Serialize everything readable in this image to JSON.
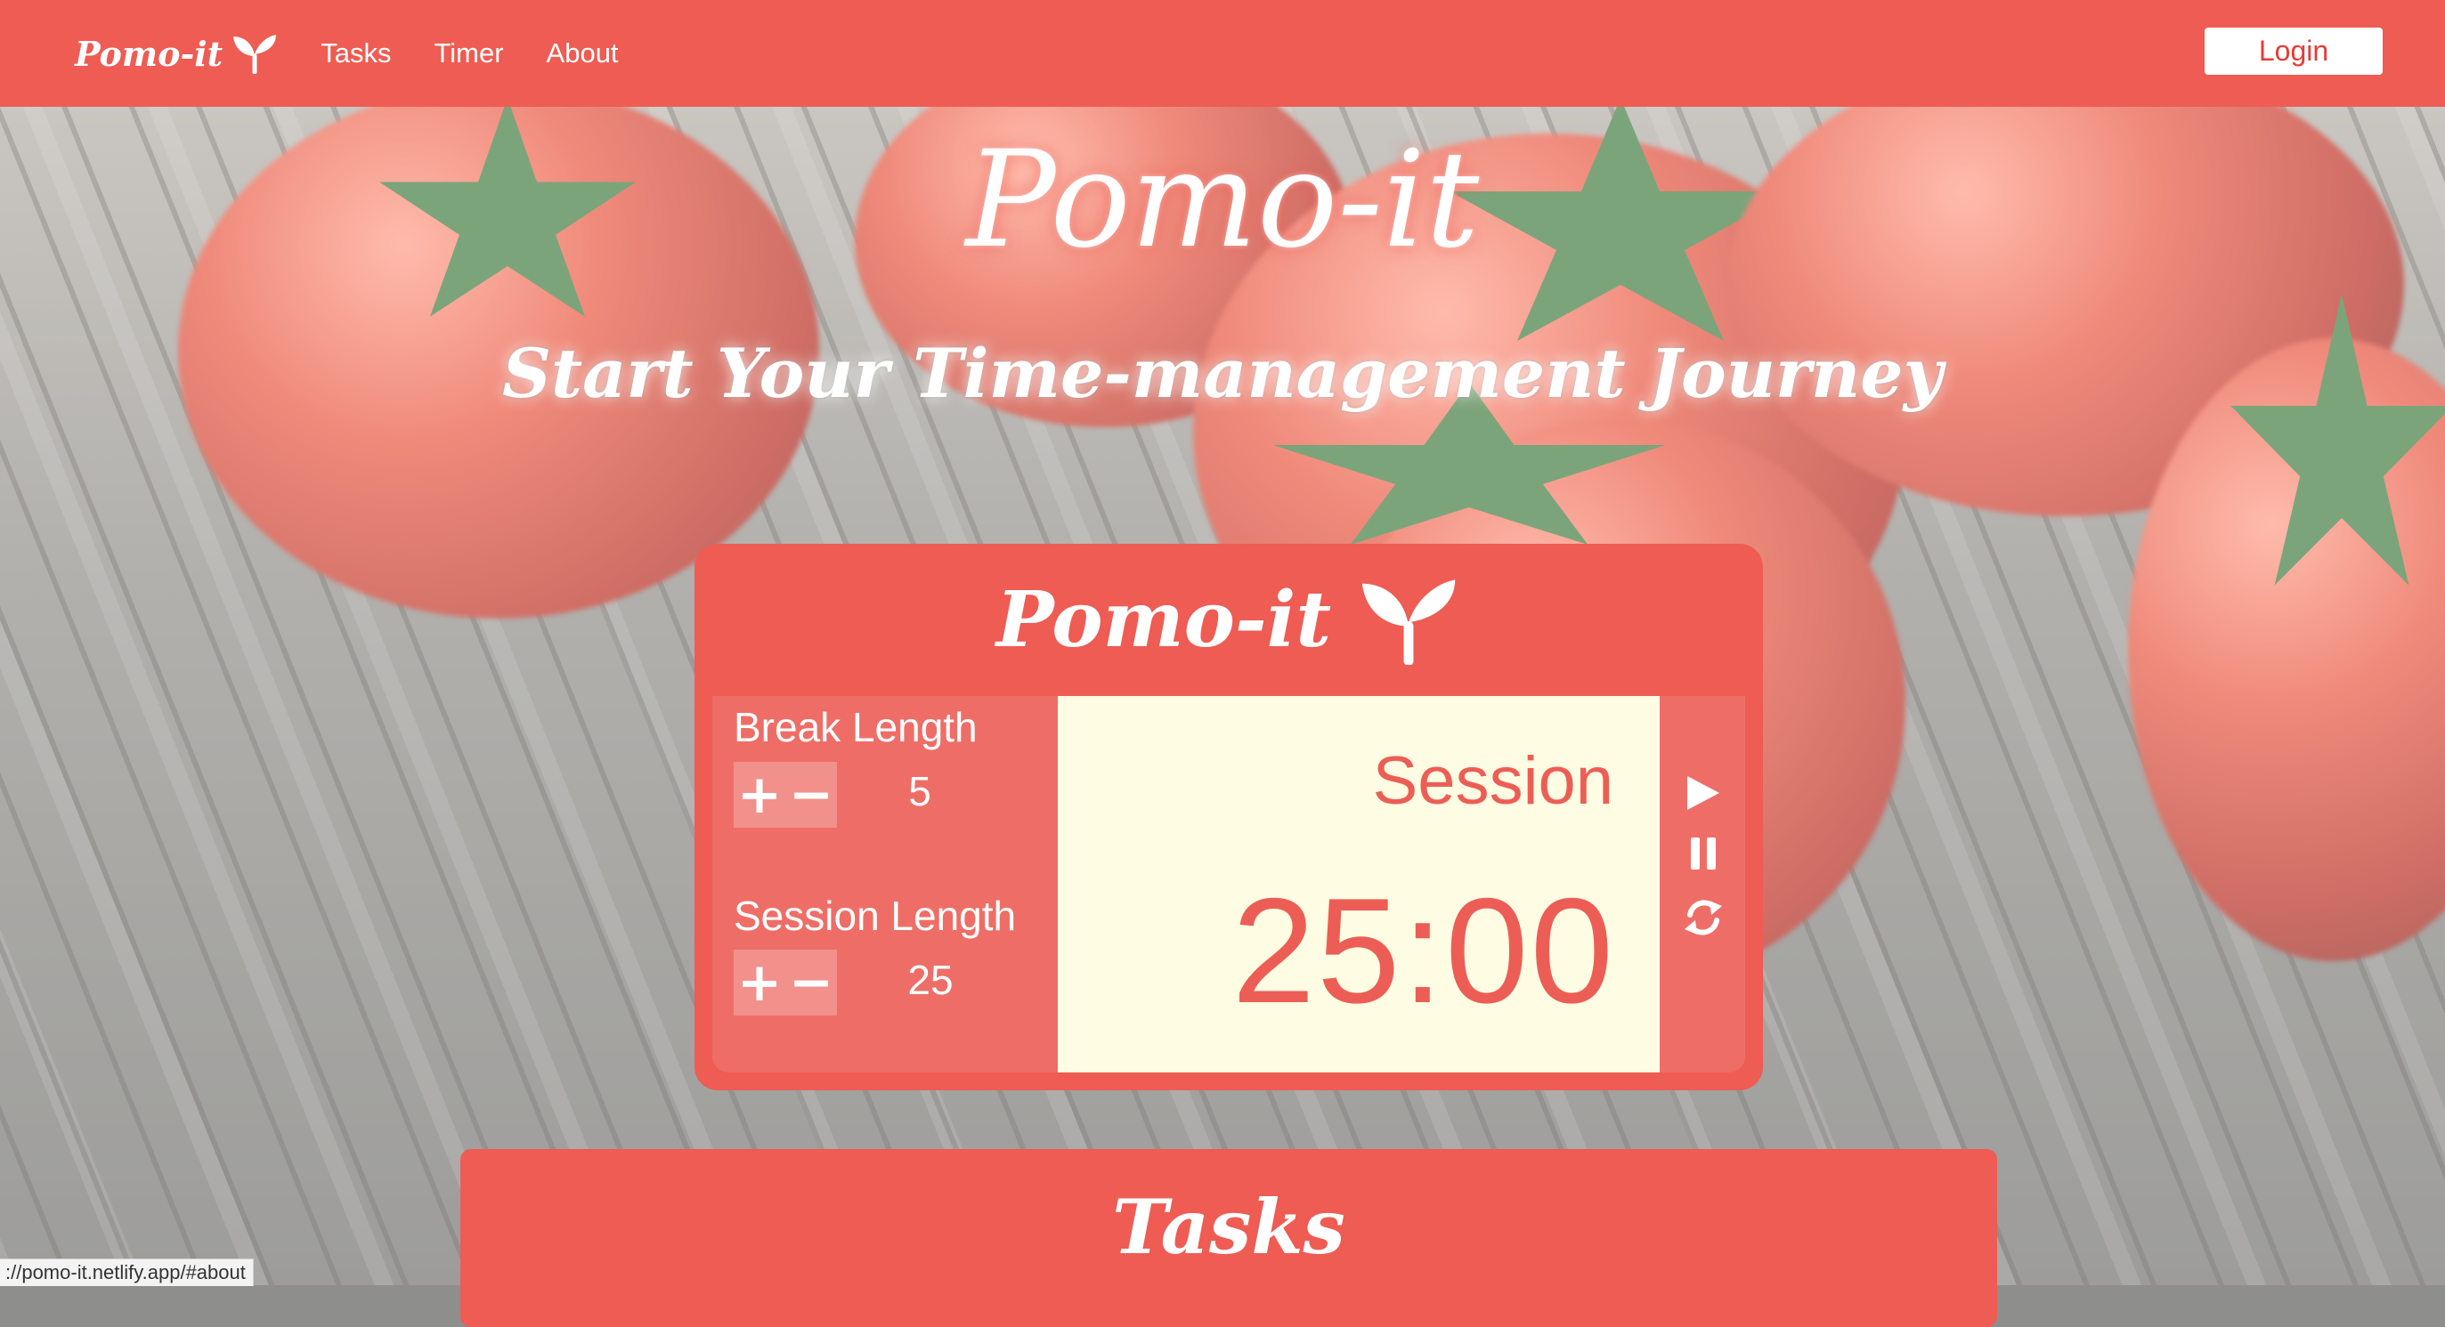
{
  "nav": {
    "brand": "Pomo-it",
    "links": [
      "Tasks",
      "Timer",
      "About"
    ],
    "login": "Login"
  },
  "hero": {
    "title": "Pomo-it",
    "subtitle": "Start Your Time-management Journey"
  },
  "timer_card": {
    "title": "Pomo-it",
    "break": {
      "label": "Break Length",
      "value": "5",
      "plus": "+",
      "minus": "−"
    },
    "session": {
      "label": "Session Length",
      "value": "25",
      "plus": "+",
      "minus": "−"
    },
    "display": {
      "label": "Session",
      "time": "25:00"
    },
    "actions": [
      "play-icon",
      "pause-icon",
      "refresh-icon"
    ]
  },
  "tasks": {
    "title": "Tasks"
  },
  "status_bar": {
    "url": "://pomo-it.netlify.app/#about"
  },
  "colors": {
    "primary": "#ee5c53",
    "panel": "#ee6e67",
    "display_bg": "#fefce2",
    "accent_text": "#ec5e55"
  }
}
